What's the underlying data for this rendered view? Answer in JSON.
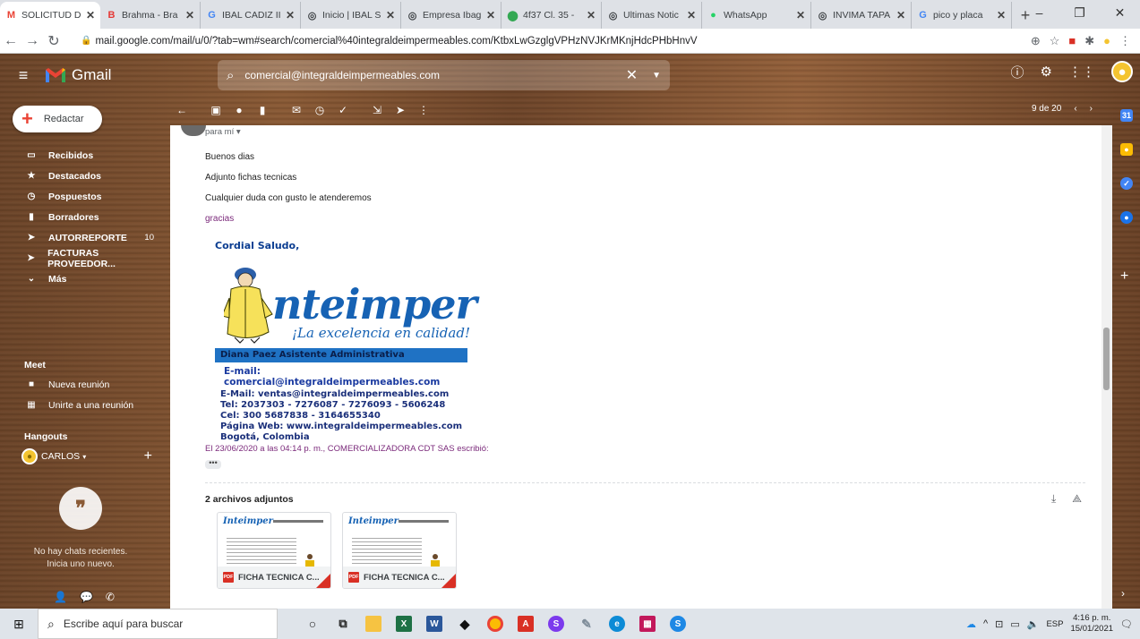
{
  "browser": {
    "tabs": [
      {
        "label": "SOLICITUD D",
        "favicon": "gmail-icon",
        "active": true
      },
      {
        "label": "Brahma - Bra",
        "favicon": "blogger-b-icon",
        "active": false
      },
      {
        "label": "IBAL CADIZ II",
        "favicon": "google-g-icon",
        "active": false
      },
      {
        "label": "Inicio | IBAL S",
        "favicon": "globe-icon",
        "active": false
      },
      {
        "label": "Empresa Ibag",
        "favicon": "globe-icon",
        "active": false
      },
      {
        "label": "4f37 Cl. 35 -",
        "favicon": "maps-pin-icon",
        "active": false
      },
      {
        "label": "Ultimas Notic",
        "favicon": "globe-icon",
        "active": false
      },
      {
        "label": "WhatsApp",
        "favicon": "whatsapp-icon",
        "active": false
      },
      {
        "label": "INVIMA TAPA",
        "favicon": "globe-icon",
        "active": false
      },
      {
        "label": "pico y placa",
        "favicon": "google-g-icon",
        "active": false
      }
    ],
    "url": "mail.google.com/mail/u/0/?tab=wm#search/comercial%40integraldeimpermeables.com/KtbxLwGzglgVPHzNVJKrMKnjHdcPHbHnvV"
  },
  "gmail": {
    "wordmark": "Gmail",
    "search_value": "comercial@integraldeimpermeables.com",
    "compose_label": "Redactar",
    "nav": [
      {
        "label": "Recibidos",
        "icon": "inbox-icon",
        "count": ""
      },
      {
        "label": "Destacados",
        "icon": "star-icon",
        "count": ""
      },
      {
        "label": "Pospuestos",
        "icon": "clock-icon",
        "count": ""
      },
      {
        "label": "Borradores",
        "icon": "draft-icon",
        "count": ""
      },
      {
        "label": "AUTORREPORTE",
        "icon": "label-icon",
        "count": "10"
      },
      {
        "label": "FACTURAS PROVEEDOR...",
        "icon": "label-icon",
        "count": ""
      },
      {
        "label": "Más",
        "icon": "chevron-down-icon",
        "count": ""
      }
    ],
    "meet": {
      "title": "Meet",
      "new_meeting": "Nueva reunión",
      "join_meeting": "Unirte a una reunión"
    },
    "hangouts": {
      "title": "Hangouts",
      "user": "CARLOS",
      "no_chats_line1": "No hay chats recientes.",
      "no_chats_line2": "Inicia uno nuevo."
    },
    "pager": {
      "text": "9 de 20"
    }
  },
  "email": {
    "to": "para mí",
    "lines": [
      "Buenos dias",
      "Adjunto fichas tecnicas",
      "Cualquier duda con gusto le atenderemos"
    ],
    "closing": "gracias",
    "signature": {
      "greeting": "Cordial Saludo,",
      "logo_word": "nteimper",
      "logo_tagline": "¡La excelencia en calidad!",
      "band": "Diana Paez Asistente Administrativa",
      "email1": "E-mail: comercial@integraldeimpermeables.com",
      "email2": "E-Mail:  ventas@integraldeimpermeables.com",
      "tel": "Tel: 2037303 - 7276087 - 7276093 - 5606248",
      "cel": "Cel: 300 5687838 - 3164655340",
      "web": "Página Web: www.integraldeimpermeables.com",
      "city": "Bogotá, Colombia"
    },
    "quote": "El 23/06/2020 a las 04:14 p. m., COMERCIALIZADORA CDT SAS escribió:",
    "attachments_title": "2 archivos adjuntos",
    "attachments": [
      {
        "name": "FICHA TECNICA C...",
        "thumb_logo": "Inteimper"
      },
      {
        "name": "FICHA TECNICA C...",
        "thumb_logo": "Inteimper"
      }
    ]
  },
  "taskbar": {
    "search_placeholder": "Escribe aquí para buscar",
    "lang": "ESP",
    "time": "4:16 p. m.",
    "date": "15/01/2021"
  },
  "colors": {
    "gmail_red": "#ea4335",
    "brand_blue": "#1662b4",
    "quote_purple": "#7b2a7b"
  }
}
